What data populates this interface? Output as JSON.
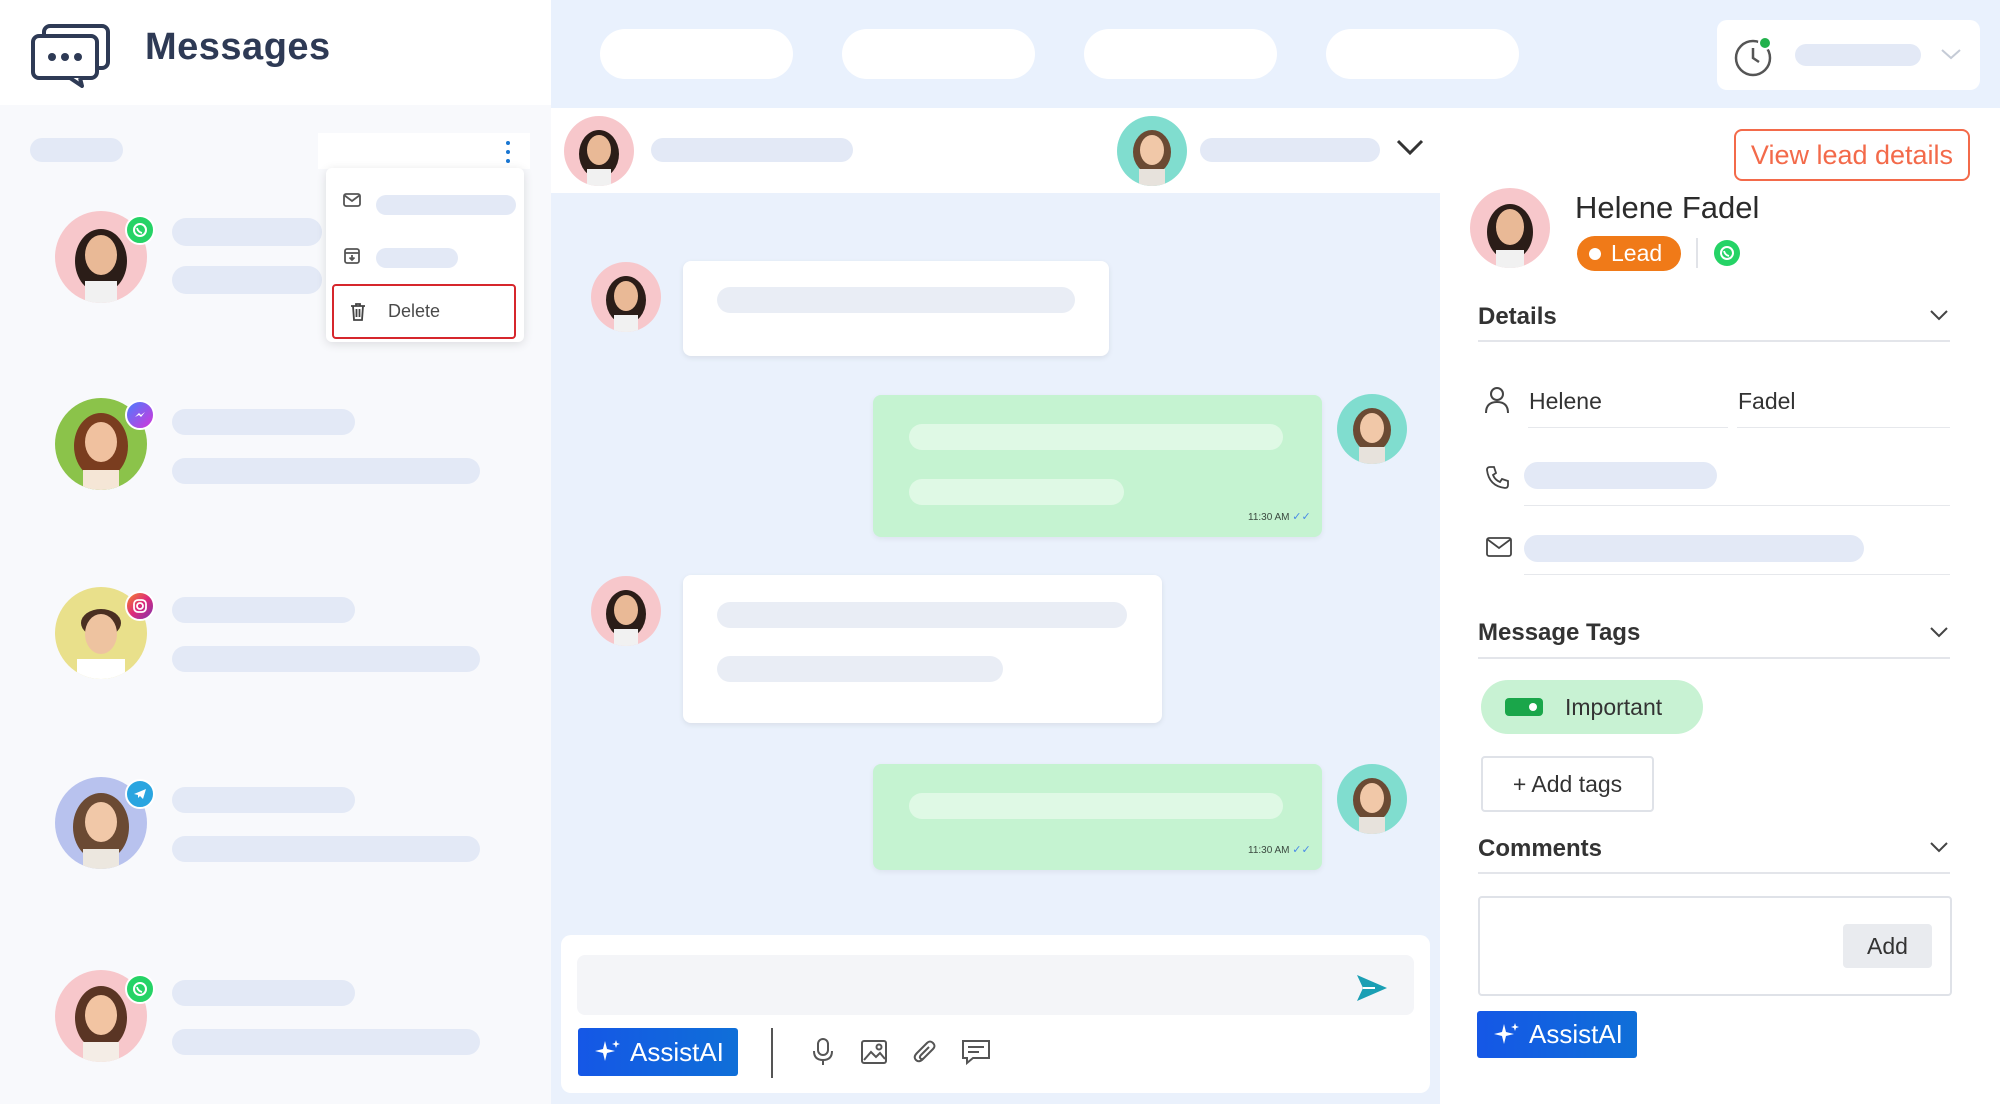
{
  "app": {
    "title": "Messages"
  },
  "menu": {
    "delete_label": "Delete"
  },
  "chat": {
    "messages": [
      {
        "direction": "outgoing",
        "time": "11:30 AM"
      },
      {
        "direction": "outgoing",
        "time": "11:30 AM"
      }
    ],
    "composer": {
      "assist_label": "AssistAI"
    }
  },
  "lead": {
    "view_button": "View lead details",
    "name": "Helene Fadel",
    "status": "Lead",
    "sections": {
      "details": "Details",
      "tags": "Message Tags",
      "comments": "Comments"
    },
    "first_name": "Helene",
    "last_name": "Fadel",
    "tags": [
      {
        "label": "Important"
      }
    ],
    "add_tags_label": "+ Add tags",
    "add_comment_label": "Add",
    "assist_label": "AssistAI"
  },
  "colors": {
    "accent_orange": "#f36a4a",
    "lead_badge": "#f07a18",
    "outgoing_bubble": "#c5f3d1",
    "assist_button": "#1557e6",
    "delete_border": "#d6262c",
    "whatsapp": "#25d366"
  }
}
